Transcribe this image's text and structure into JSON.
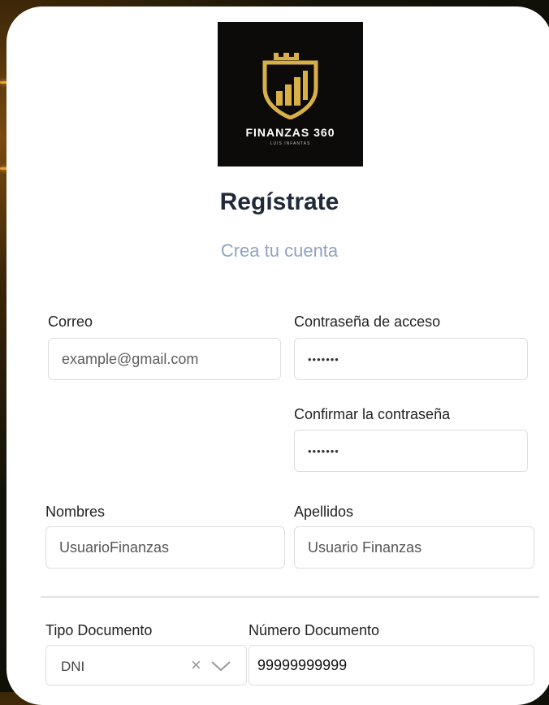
{
  "logo": {
    "brand": "FINANZAS 360",
    "sub": "LUIS INFANTAS"
  },
  "page": {
    "title": "Regístrate",
    "subtitle": "Crea tu cuenta"
  },
  "form": {
    "email": {
      "label": "Correo",
      "placeholder": "example@gmail.com"
    },
    "password": {
      "label": "Contraseña de acceso",
      "value": "•••••••"
    },
    "confirm": {
      "label": "Confirmar la contraseña",
      "value": "•••••••"
    },
    "first_name": {
      "label": "Nombres",
      "value": "UsuarioFinanzas"
    },
    "last_name": {
      "label": "Apellidos",
      "value": "Usuario Finanzas"
    },
    "doc_type": {
      "label": "Tipo Documento",
      "value": "DNI"
    },
    "doc_number": {
      "label": "Número Documento",
      "value": "99999999999"
    }
  },
  "icons": {
    "clear": "close-icon",
    "dropdown": "chevron-down-icon",
    "logo": "shield-chart-icon"
  },
  "colors": {
    "gold": "#c9a13b",
    "title": "#1f2937",
    "subtitle": "#8fa3c0"
  }
}
